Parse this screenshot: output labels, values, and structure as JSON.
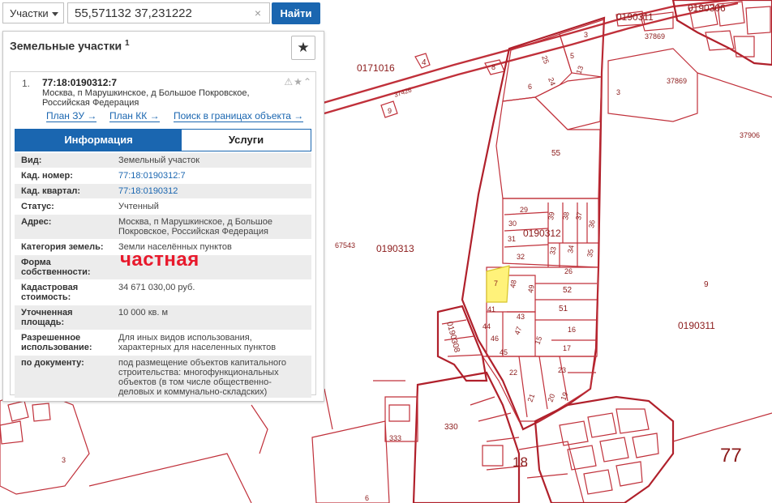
{
  "search": {
    "type_selected": "Участки",
    "query_value": "55,571132 37,231222",
    "clear_glyph": "×",
    "button_label": "Найти"
  },
  "panel": {
    "title": "Земельные участки",
    "title_count": "1",
    "result": {
      "index": "1.",
      "cad_number": "77:18:0190312:7",
      "address": "Москва, п Марушкинское, д Большое Покровское, Российская Федерация",
      "links": [
        "План ЗУ →",
        "План КК →",
        "Поиск в границах объекта →"
      ]
    },
    "tabs": [
      "Информация",
      "Услуги"
    ],
    "fields": [
      {
        "label": "Вид:",
        "value": "Земельный участок"
      },
      {
        "label": "Кад. номер:",
        "value": "77:18:0190312:7"
      },
      {
        "label": "Кад. квартал:",
        "value": "77:18:0190312"
      },
      {
        "label": "Статус:",
        "value": "Учтенный"
      },
      {
        "label": "Адрес:",
        "value": "Москва, п Марушкинское, д Большое Покровское, Российская Федерация"
      },
      {
        "label": "Категория земель:",
        "value": "Земли населённых пунктов"
      },
      {
        "label": "Форма собственности:",
        "value": ""
      },
      {
        "label": "Кадастровая стоимость:",
        "value": "34 671 030,00 руб."
      },
      {
        "label": "Уточненная площадь:",
        "value": "10 000 кв. м"
      },
      {
        "label": "Разрешенное использование:",
        "value": "Для иных видов использования, характерных для населенных пунктов"
      },
      {
        "label": "по документу:",
        "value": "под размещение объектов капитального строительства: многофункциональных объектов (в том числе общественно-деловых и коммунально-складских)"
      }
    ],
    "handwritten_note": "частная"
  },
  "map": {
    "highlight_color": "#fff27a",
    "line_color": "#c0303a",
    "labels": {
      "q0190311_top": "0190311",
      "q0190306": "0190306",
      "n37869_top": "37869",
      "n37869": "37869",
      "q0171016": "0171016",
      "n4": "4",
      "n37426": "37426",
      "n9_left": "9",
      "n8": "8",
      "n3_top": "3",
      "n5": "5",
      "n25": "25",
      "n24": "24",
      "n13": "13",
      "n6": "6",
      "n3_right": "3",
      "n37906": "37906",
      "n55": "55",
      "n29": "29",
      "n39": "39",
      "n38": "38",
      "n37": "37",
      "n30": "30",
      "n36": "36",
      "q0190312": "0190312",
      "n31": "31",
      "n34": "34",
      "n33": "33",
      "n35": "35",
      "n32": "32",
      "n26": "26",
      "n67543": "67543",
      "q0190313": "0190313",
      "n7": "7",
      "n48": "48",
      "n49": "49",
      "n52": "52",
      "n9_right": "9",
      "n41": "41",
      "n43": "43",
      "n51": "51",
      "n44": "44",
      "n47": "47",
      "n16": "16",
      "q0190311_right": "0190311",
      "q0190308": "0190308",
      "n46": "46",
      "n15": "15",
      "n45": "45",
      "n17": "17",
      "n22": "22",
      "n23": "23",
      "n21": "21",
      "n20": "20",
      "n19": "19",
      "n330": "330",
      "n333": "333",
      "n18": "18",
      "n77": "77",
      "n3_bottom": "3",
      "n6_bottom": "6"
    }
  }
}
